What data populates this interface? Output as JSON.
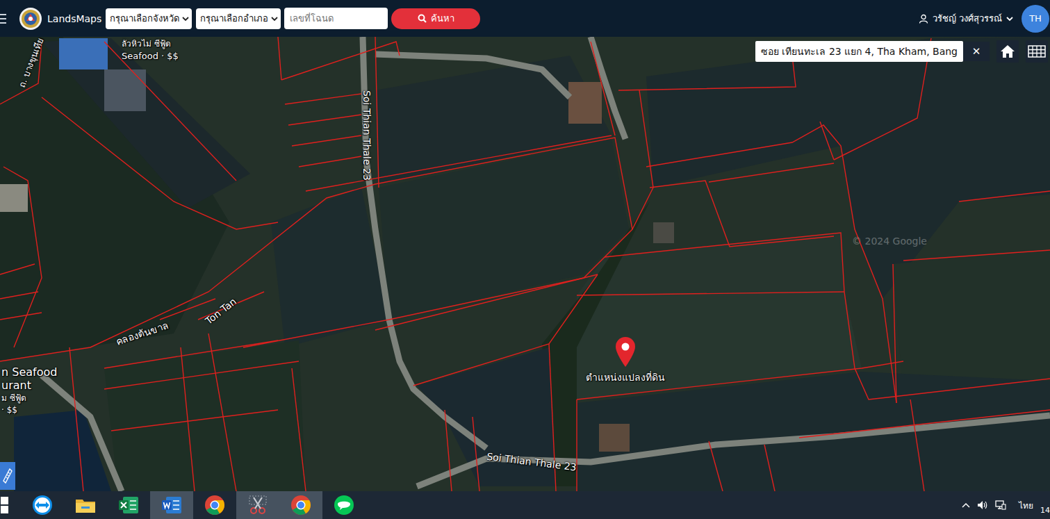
{
  "navbar": {
    "brand": "LandsMaps",
    "province_select": {
      "value": "กรุณาเลือกจังหวัด"
    },
    "district_select": {
      "value": "กรุณาเลือกอำเภอ"
    },
    "deed_input": {
      "placeholder": "เลขที่โฉนด"
    },
    "search_button": "ค้นหา",
    "user": {
      "name": "วรัชญ์ วงศ์สุวรรณ์"
    },
    "language": "TH"
  },
  "map": {
    "search": {
      "value": "ซอย เทียนทะเล 23 แยก 4, Tha Kham, Bang",
      "clear": "✕"
    },
    "labels": [
      {
        "text": "Soi Thian Thale 23"
      },
      {
        "text": "Soi Thian Thale 23"
      },
      {
        "text": "คลองต้นขาล"
      },
      {
        "text": "Ton Tan"
      },
      {
        "text": "Seafood · $$"
      },
      {
        "text": "ถ. บางขุนเทีย"
      },
      {
        "text": "ลัวหิวไม่ ซีฟู้ด"
      },
      {
        "text": "n Seafood"
      },
      {
        "text": "urant"
      },
      {
        "text": "ม ซีฟู้ด"
      },
      {
        "text": "· $$"
      },
      {
        "text": "© 2024 Google"
      }
    ],
    "pin": {
      "label": "ตำแหน่งแปลงที่ดิน"
    }
  },
  "taskbar": {
    "apps": [
      {
        "kind": "start",
        "active": false
      },
      {
        "kind": "teamviewer",
        "active": false
      },
      {
        "kind": "explorer",
        "active": false
      },
      {
        "kind": "excel",
        "active": false
      },
      {
        "kind": "word",
        "active": true
      },
      {
        "kind": "chrome",
        "active": false
      },
      {
        "kind": "snipping",
        "active": true
      },
      {
        "kind": "chrome",
        "active": true
      },
      {
        "kind": "line",
        "active": false
      }
    ],
    "tray": {
      "language": "ไทย",
      "clock": "14"
    }
  }
}
